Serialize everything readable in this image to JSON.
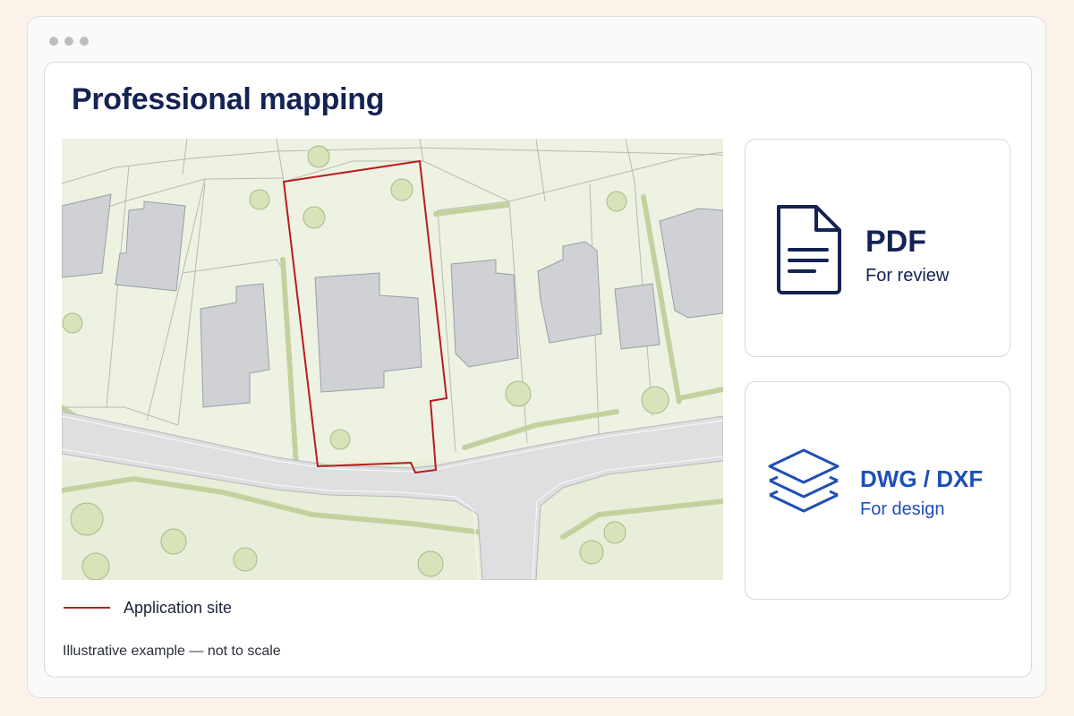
{
  "page": {
    "title": "Professional mapping"
  },
  "legend": {
    "label": "Application site",
    "color": "#b71c1c"
  },
  "disclaimer": "Illustrative example — not to scale",
  "cards": [
    {
      "format": "PDF",
      "subtitle": "For review",
      "icon": "document-icon",
      "color": "#142353"
    },
    {
      "format": "DWG / DXF",
      "subtitle": "For design",
      "icon": "layers-icon",
      "color": "#1f4fb8"
    }
  ],
  "colors": {
    "background": "#fbf3ea",
    "map_land": "#eef2e3",
    "building": "#cfd1d4",
    "road": "#dedfe1",
    "site_boundary": "#b71c1c",
    "tree": "#cfdcaa"
  }
}
